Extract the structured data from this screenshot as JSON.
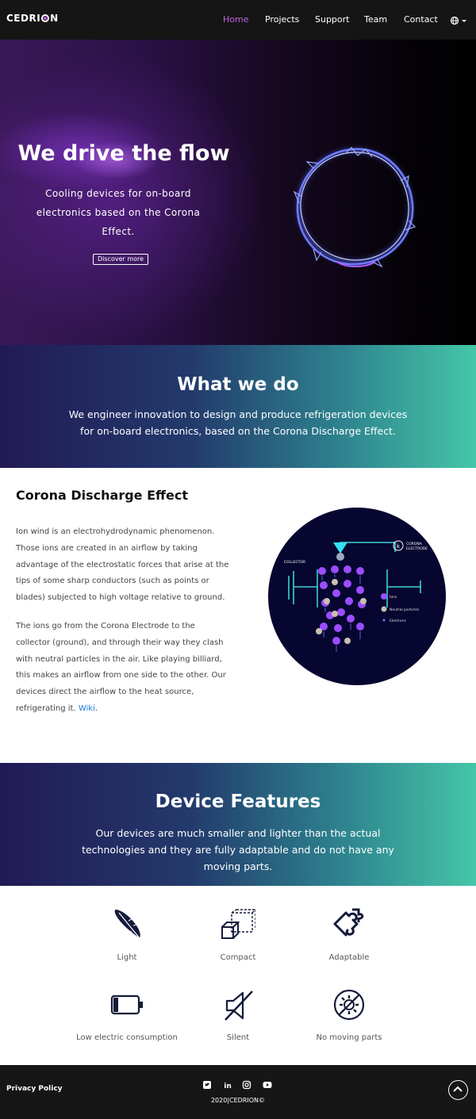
{
  "brand": {
    "logo_text": "CEDRION"
  },
  "nav": {
    "items": [
      {
        "label": "Home",
        "active": true
      },
      {
        "label": "Projects"
      },
      {
        "label": "Support"
      },
      {
        "label": "Team"
      },
      {
        "label": "Contact"
      }
    ],
    "language_icon": "globe-icon",
    "active_color": "#c064e6"
  },
  "hero": {
    "title": "We drive the flow",
    "subtitle": "Cooling devices for on-board electronics based on the Corona Effect.",
    "button_label": "Discover more"
  },
  "what_we_do": {
    "title": "What we do",
    "text": "We engineer innovation to design and produce refrigeration devices for on-board electronics, based on the Corona Discharge Effect."
  },
  "corona": {
    "title": "Corona Discharge Effect",
    "para1": "Ion wind is an electrohydrodynamic phenomenon. Those ions are created in an airflow by taking advantage of the electrostatic forces that arise at the tips of some sharp conductors (such as points or blades) subjected to high voltage relative to ground.",
    "para2": "The ions go from the Corona Electrode to the collector (ground), and through their way they clash with neutral particles in the air. Like playing billiard, this makes an airflow from one side to the other. Our devices direct the airflow to the heat source, refrigerating it.",
    "wiki_link": "Wiki",
    "para2_end": ".",
    "diagram": {
      "collector_label": "COLLECTOR",
      "electrode_label_1": "CORONA",
      "electrode_label_2": "ELECTRODE",
      "k_label": "k",
      "legend": [
        "Ions",
        "Neutral particles",
        "Electrons"
      ]
    }
  },
  "features_band": {
    "title": "Device Features",
    "text": "Our devices are much smaller and lighter than the actual technologies and they are fully adaptable and do not have any moving parts."
  },
  "features": [
    {
      "label": "Light",
      "icon": "feather-icon"
    },
    {
      "label": "Compact",
      "icon": "cube-icon"
    },
    {
      "label": "Adaptable",
      "icon": "puzzle-icon"
    },
    {
      "label": "Low electric consumption",
      "icon": "battery-icon"
    },
    {
      "label": "Silent",
      "icon": "mute-icon"
    },
    {
      "label": "No moving parts",
      "icon": "no-gear-icon"
    }
  ],
  "footer": {
    "privacy": "Privacy Policy",
    "copyright": "2020|CEDRION©",
    "social_icons": [
      "twitter-icon",
      "linkedin-icon",
      "instagram-icon",
      "youtube-icon"
    ]
  },
  "colors": {
    "accent": "#c064e6",
    "band_start": "#221a55",
    "band_end": "#45c6a8",
    "link": "#1f7bd1"
  }
}
